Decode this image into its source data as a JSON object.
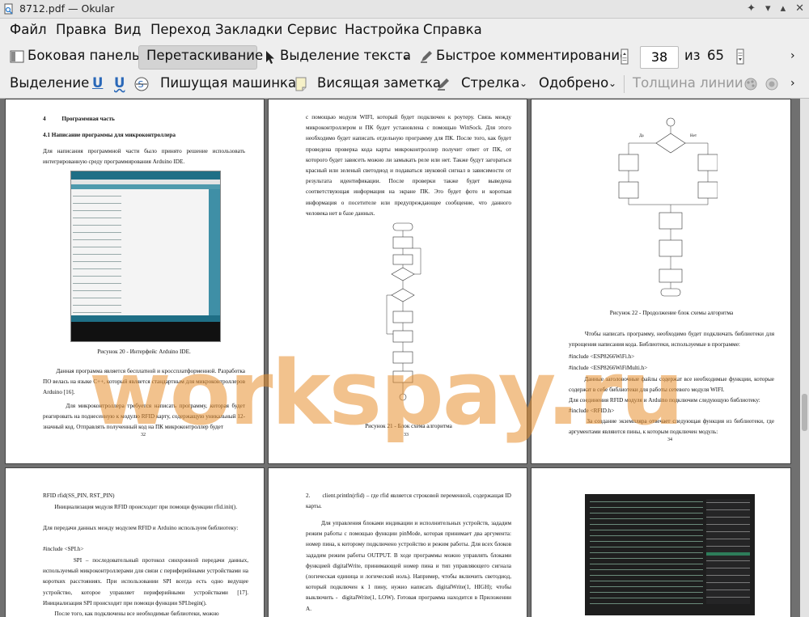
{
  "window": {
    "title": "8712.pdf — Okular"
  },
  "menu": [
    "Файл",
    "Правка",
    "Вид",
    "Переход",
    "Закладки",
    "Сервис",
    "Настройка",
    "Справка"
  ],
  "toolbar": {
    "sidebar": "Боковая панель",
    "drag": "Перетаскивание",
    "text_select": "Выделение текста",
    "quick_comment": "Быстрое комментирование",
    "page_current": "38",
    "page_of": "из",
    "page_total": "65"
  },
  "annot_toolbar": {
    "highlight": "Выделение",
    "typewriter": "Пишущая машинка",
    "sticky_note": "Висящая заметка",
    "arrow": "Стрелка",
    "stamp": "Одобрено",
    "line_width": "Толщина линии"
  },
  "watermark": "workspay.ru",
  "pages": {
    "p32": {
      "heading": "4           Программная часть",
      "subheading": "4.1 Написание программы для микроконтроллера",
      "para1": "Для написания программной части было принято решение использовать интегрированную среду программирования Arduino IDE.",
      "caption": "Рисунок 20 - Интерфейс Arduino IDE.",
      "para2": "        Данная программа является бесплатной и кроссплатформенной. Разработка ПО велась на языке С++, который является стандартным для микроконтроллеров Arduino [16].",
      "para3": "        Для микроконтроллера требуется написать программу, которая будет реагировать на поднесенную к модулю RFID карту, содержащую уникальный 12-значный код. Отправлять полученный код на ПК микроконтроллер будет",
      "num": "32"
    },
    "p33": {
      "para": "с помощью модуля WIFI, который будет подключен к роутеру. Связь между микроконтроллером и ПК будет установлена с помощью WinSock. Для этого необходимо будет написать отдельную программу для ПК. После того, как будет проведена проверка кода карты микроконтроллер получит ответ от ПК, от которого будет зависеть можно ли замыкать реле или нет. Также будут загораться красный или зеленый светодиод и подаваться звуковой сигнал в зависимости от результата идентификации. После проверки также будет выведена соответствующая информация на экране ПК. Это будет фото и короткая информация о посетителе или предупреждающее сообщение, что данного человека нет в базе данных.",
      "caption": "Рисунок 21 - Блок схема алгоритма",
      "num": "33"
    },
    "p34": {
      "caption": "Рисунок 22 - Продолжение блок схемы алгоритма",
      "yes": "Да",
      "no": "Нет",
      "para1": "        Чтобы написать программу, необходимо будет подключать библиотеки для упрощения написания кода. Библиотеки, используемые в программе:",
      "inc1": "#include <ESP8266WiFi.h>",
      "inc2": "#include <ESP8266WiFiMulti.h>",
      "para2": "        Данные заголовочные файлы содержат все необходимые функции, которые содержат в себе библиотеки для работы сетевого модуля WIFI.",
      "para3": "Для соединения RFID модуля и Arduino подключим следующую библиотеку:",
      "inc3": "#include <RFID.h>",
      "para4": "        За создание экземпляра отвечает следующая функция из библиотеки, где аргументами являются пины, к которым подключен модуль:",
      "num": "34"
    },
    "p35": {
      "line1": "RFID rfid(SS_PIN, RST_PIN)",
      "para1": "        Инициализация модуля RFID происходит при помощи функции rfid.init().",
      "para2": "Для передачи данных между модулем RFID и Arduino используем библиотеку:",
      "inc": "#include <SPI.h>",
      "para3": "        SPI – последовательный протокол синхронной передачи данных, используемый микроконтроллерами для связи с периферийными устройствами на коротких расстояниях. При использовании SPI всегда есть одно ведущее устройство, которое управляет периферийными устройствами [17]. Инициализация SPI происходит при помощи функции SPI.begin().",
      "para4": "        После того, как подключены все необходимые библиотеки, можно"
    },
    "p36": {
      "item": "2.       client.println(rfid) – где rfid является строковой переменной, содержащая ID карты.",
      "para": "        Для управления блоками индикации и исполнительных устройств, зададим режим работы с помощью функции pinMode, которая принимает два аргумента: номер пина, к которому подключено устройство и режим работы. Для всех блоков зададим режим работы OUTPUT. В ходе программы можно управлять блоками функцией digitalWrite, принимающей номер пина и тип управляющего сигнала (логическая единица и логический ноль). Например, чтобы включить светодиод, который подключен к 1 пину, нужно написать digitalWrite(1, HIGH); чтобы выключить -  digitalWrite(1, LOW). Готовая программа находится в Приложении А."
    }
  }
}
